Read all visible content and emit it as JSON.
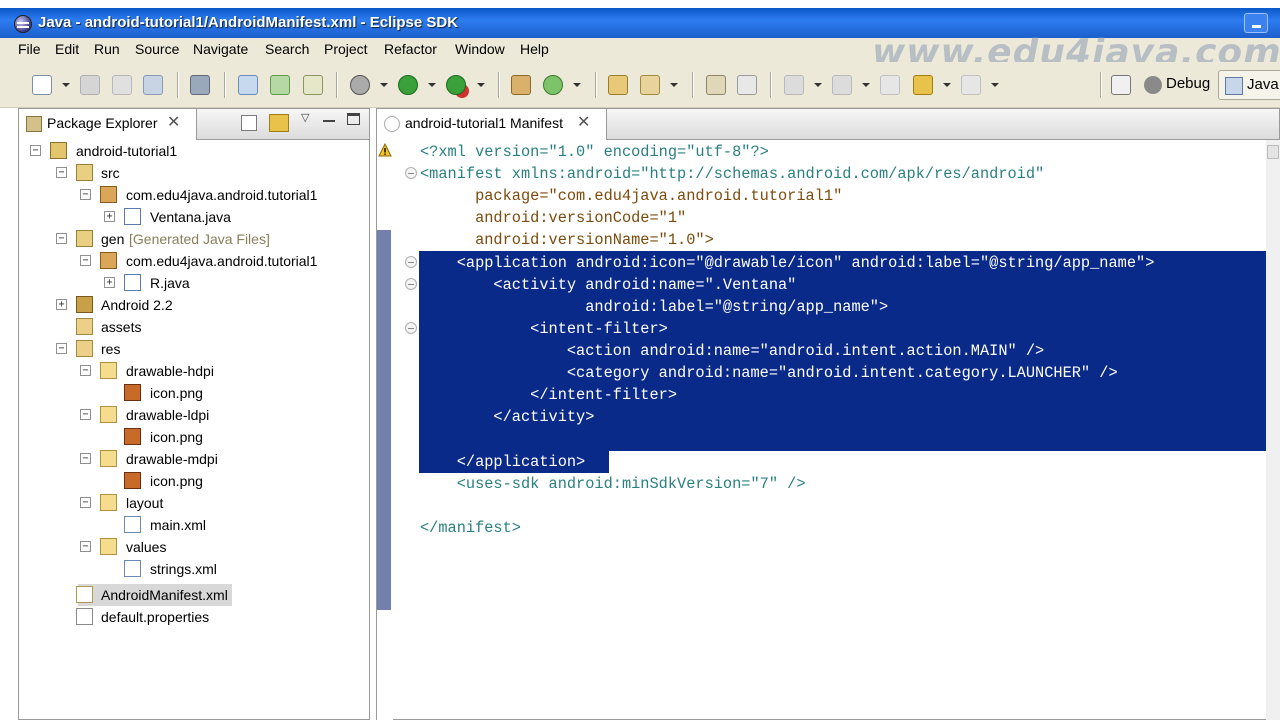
{
  "window": {
    "title": "Java - android-tutorial1/AndroidManifest.xml - Eclipse SDK"
  },
  "watermark": "www.edu4java.com",
  "menu": [
    "File",
    "Edit",
    "Run",
    "Source",
    "Navigate",
    "Search",
    "Project",
    "Refactor",
    "Window",
    "Help"
  ],
  "perspectives": {
    "debug": "Debug",
    "java": "Java"
  },
  "package_explorer": {
    "tab_label": "Package Explorer",
    "tree": [
      {
        "label": "android-tutorial1",
        "icon": "project-icon",
        "toggle": "−"
      },
      {
        "label": "src",
        "icon": "source-folder-icon",
        "toggle": "−"
      },
      {
        "label": "com.edu4java.android.tutorial1",
        "icon": "package-icon",
        "toggle": "−"
      },
      {
        "label": "Ventana.java",
        "icon": "java-file-icon",
        "toggle": "+"
      },
      {
        "label": "gen",
        "label_extra": "[Generated Java Files]",
        "icon": "source-folder-icon",
        "toggle": "−"
      },
      {
        "label": "com.edu4java.android.tutorial1",
        "icon": "package-icon",
        "toggle": "−"
      },
      {
        "label": "R.java",
        "icon": "java-file-icon",
        "toggle": "+"
      },
      {
        "label": "Android 2.2",
        "icon": "library-icon",
        "toggle": "+"
      },
      {
        "label": "assets",
        "icon": "folder-icon",
        "toggle": ""
      },
      {
        "label": "res",
        "icon": "folder-icon",
        "toggle": "−"
      },
      {
        "label": "drawable-hdpi",
        "icon": "folder-icon",
        "toggle": "−"
      },
      {
        "label": "icon.png",
        "icon": "image-file-icon",
        "toggle": ""
      },
      {
        "label": "drawable-ldpi",
        "icon": "folder-icon",
        "toggle": "−"
      },
      {
        "label": "icon.png",
        "icon": "image-file-icon",
        "toggle": ""
      },
      {
        "label": "drawable-mdpi",
        "icon": "folder-icon",
        "toggle": "−"
      },
      {
        "label": "icon.png",
        "icon": "image-file-icon",
        "toggle": ""
      },
      {
        "label": "layout",
        "icon": "folder-icon",
        "toggle": "−"
      },
      {
        "label": "main.xml",
        "icon": "xml-file-icon",
        "toggle": ""
      },
      {
        "label": "values",
        "icon": "folder-icon",
        "toggle": "−"
      },
      {
        "label": "strings.xml",
        "icon": "xml-file-icon",
        "toggle": ""
      },
      {
        "label": "AndroidManifest.xml",
        "icon": "manifest-file-icon",
        "toggle": ""
      },
      {
        "label": "default.properties",
        "icon": "properties-file-icon",
        "toggle": ""
      }
    ],
    "selected": "AndroidManifest.xml"
  },
  "editor": {
    "tab_label": "android-tutorial1 Manifest",
    "lines": [
      "<?xml version=\"1.0\" encoding=\"utf-8\"?>",
      "<manifest xmlns:android=\"http://schemas.android.com/apk/res/android\"",
      "      package=\"com.edu4java.android.tutorial1\"",
      "      android:versionCode=\"1\"",
      "      android:versionName=\"1.0\">",
      "    <application android:icon=\"@drawable/icon\" android:label=\"@string/app_name\">",
      "        <activity android:name=\".Ventana\"",
      "                  android:label=\"@string/app_name\">",
      "            <intent-filter>",
      "                <action android:name=\"android.intent.action.MAIN\" />",
      "                <category android:name=\"android.intent.category.LAUNCHER\" />",
      "            </intent-filter>",
      "        </activity>",
      "",
      "    </application>",
      "    <uses-sdk android:minSdkVersion=\"7\" />",
      "",
      "</manifest>"
    ]
  },
  "colors": {
    "title_bar": "#1c5fcc",
    "selection": "#0a2a8a",
    "xml_tag": "#2a8080",
    "xml_attr": "#7d4b0c",
    "xml_value": "#2020ff"
  }
}
